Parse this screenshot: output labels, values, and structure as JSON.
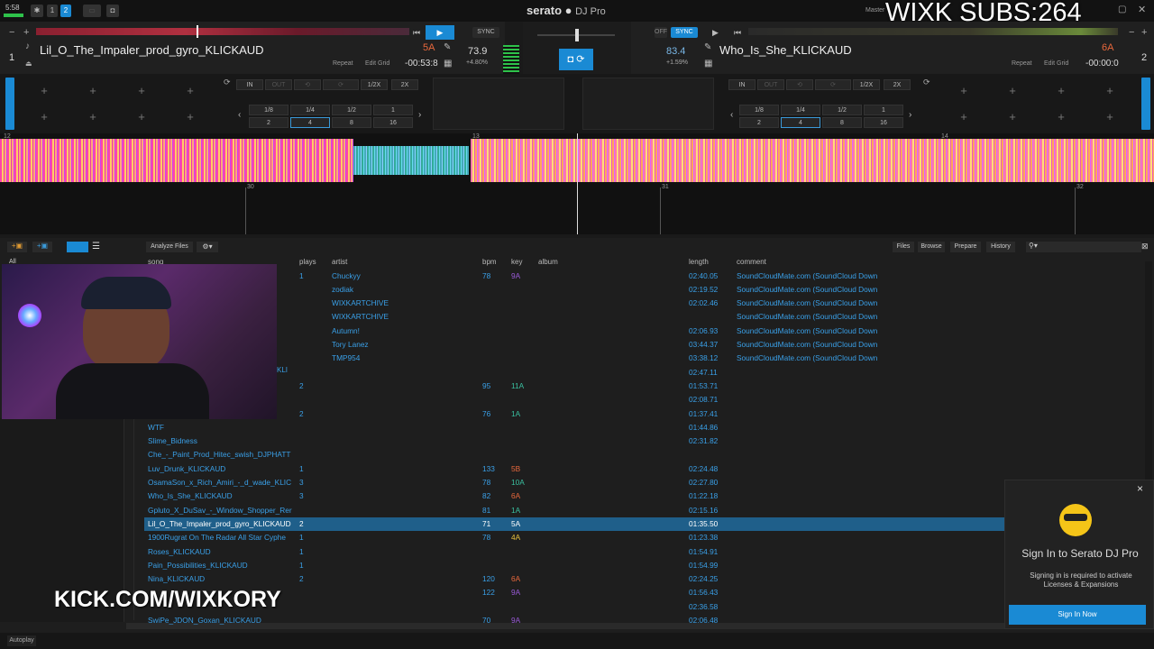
{
  "topbar": {
    "clock": "5:58",
    "deck1_label": "1",
    "deck2_label": "2",
    "logo": "serato",
    "logo_sub": "DJ Pro",
    "overlay_subs": "WIXK SUBS:264",
    "master_label": "Master"
  },
  "deck_left": {
    "number": "1",
    "title": "Lil_O_The_Impaler_prod_gyro_KLICKAUD",
    "key": "5A",
    "time": "-00:53:8",
    "repeat": "Repeat",
    "edit_grid": "Edit Grid",
    "bpm": "73.9",
    "pitch": "+4.80%",
    "sync": "SYNC"
  },
  "deck_right": {
    "number": "2",
    "title": "Who_Is_She_KLICKAUD",
    "key": "6A",
    "time": "-00:00:0",
    "repeat": "Repeat",
    "edit_grid": "Edit Grid",
    "bpm": "83.4",
    "pitch": "+1.59%",
    "sync": "SYNC",
    "off": "OFF"
  },
  "loop_controls": {
    "in": "IN",
    "out": "OUT",
    "half": "1/2X",
    "double": "2X",
    "sizes_top": [
      "1/8",
      "1/4",
      "1/2",
      "1"
    ],
    "sizes_bottom": [
      "2",
      "4",
      "8",
      "16"
    ]
  },
  "wave_markers": {
    "top": [
      "12",
      "13",
      "14"
    ],
    "bottom": [
      "30",
      "31",
      "32"
    ]
  },
  "browser_toolbar": {
    "analyze": "Analyze Files",
    "files": "Files",
    "browse": "Browse",
    "prepare": "Prepare",
    "history": "History",
    "all": "All"
  },
  "columns": {
    "song": "song",
    "plays": "plays",
    "artist": "artist",
    "bpm": "bpm",
    "key": "key",
    "album": "album",
    "length": "length",
    "comment": "comment"
  },
  "tracks": [
    {
      "song": "",
      "plays": "1",
      "artist": "Chuckyy",
      "bpm": "78",
      "key": "9A",
      "length": "02:40.05",
      "comment": "SoundCloudMate.com (SoundCloud Down"
    },
    {
      "song": "",
      "plays": "",
      "artist": "zodiak",
      "bpm": "",
      "key": "",
      "length": "02:19.52",
      "comment": "SoundCloudMate.com (SoundCloud Down"
    },
    {
      "song": "",
      "plays": "",
      "artist": "WIXKARTCHIVE",
      "bpm": "",
      "key": "",
      "length": "02:02.46",
      "comment": "SoundCloudMate.com (SoundCloud Down"
    },
    {
      "song": "",
      "plays": "",
      "artist": "WIXKARTCHIVE",
      "bpm": "",
      "key": "",
      "length": "",
      "comment": "SoundCloudMate.com (SoundCloud Down"
    },
    {
      "song": "",
      "plays": "",
      "artist": "Autumn!",
      "bpm": "",
      "key": "",
      "length": "02:06.93",
      "comment": "SoundCloudMate.com (SoundCloud Down"
    },
    {
      "song": "",
      "plays": "",
      "artist": "Tory Lanez",
      "bpm": "",
      "key": "",
      "length": "03:44.37",
      "comment": "SoundCloudMate.com (SoundCloud Down"
    },
    {
      "song": "",
      "plays": "",
      "artist": "TMP954",
      "bpm": "",
      "key": "",
      "length": "03:38.12",
      "comment": "SoundCloudMate.com (SoundCloud Down"
    },
    {
      "song": "",
      "plays": "",
      "artist": "",
      "bpm": "",
      "key": "",
      "length": "02:47.11",
      "comment": ""
    },
    {
      "song": "",
      "plays": "2",
      "artist": "",
      "bpm": "95",
      "key": "11A",
      "length": "01:53.71",
      "comment": ""
    },
    {
      "song": "",
      "plays": "",
      "artist": "",
      "bpm": "",
      "key": "",
      "length": "02:08.71",
      "comment": ""
    },
    {
      "song": "",
      "plays": "2",
      "artist": "",
      "bpm": "76",
      "key": "1A",
      "length": "01:37.41",
      "comment": ""
    },
    {
      "song": "WTF",
      "plays": "",
      "artist": "",
      "bpm": "",
      "key": "",
      "length": "01:44.86",
      "comment": ""
    },
    {
      "song": "Slime_Bidness",
      "plays": "",
      "artist": "",
      "bpm": "",
      "key": "",
      "length": "02:31.82",
      "comment": ""
    },
    {
      "song": "Che_-_Paint_Prod_Hitec_swish_DJPHATT",
      "plays": "",
      "artist": "",
      "bpm": "",
      "key": "",
      "length": "",
      "comment": ""
    },
    {
      "song": "Luv_Drunk_KLICKAUD",
      "plays": "1",
      "artist": "",
      "bpm": "133",
      "key": "5B",
      "length": "02:24.48",
      "comment": ""
    },
    {
      "song": "OsamaSon_x_Rich_Amiri_-_d_wade_KLIC",
      "plays": "3",
      "artist": "",
      "bpm": "78",
      "key": "10A",
      "length": "02:27.80",
      "comment": ""
    },
    {
      "song": "Who_Is_She_KLICKAUD",
      "plays": "3",
      "artist": "",
      "bpm": "82",
      "key": "6A",
      "length": "01:22.18",
      "comment": ""
    },
    {
      "song": "Gpluto_X_DuSav_-_Window_Shopper_Rer",
      "plays": "",
      "artist": "",
      "bpm": "81",
      "key": "1A",
      "length": "02:15.16",
      "comment": ""
    },
    {
      "song": "Lil_O_The_Impaler_prod_gyro_KLICKAUD",
      "plays": "2",
      "artist": "",
      "bpm": "71",
      "key": "5A",
      "length": "01:35.50",
      "comment": ""
    },
    {
      "song": "1900Rugrat  On The Radar All Star Cyphe",
      "plays": "1",
      "artist": "",
      "bpm": "78",
      "key": "4A",
      "length": "01:23.38",
      "comment": ""
    },
    {
      "song": "Roses_KLICKAUD",
      "plays": "1",
      "artist": "",
      "bpm": "",
      "key": "",
      "length": "01:54.91",
      "comment": ""
    },
    {
      "song": "Pain_Possibilities_KLICKAUD",
      "plays": "1",
      "artist": "",
      "bpm": "",
      "key": "",
      "length": "01:54.99",
      "comment": ""
    },
    {
      "song": "Nina_KLICKAUD",
      "plays": "2",
      "artist": "",
      "bpm": "120",
      "key": "6A",
      "length": "02:24.25",
      "comment": ""
    },
    {
      "song": "",
      "plays": "",
      "artist": "",
      "bpm": "122",
      "key": "9A",
      "length": "01:56.43",
      "comment": ""
    },
    {
      "song": "",
      "plays": "",
      "artist": "",
      "bpm": "",
      "key": "",
      "length": "02:36.58",
      "comment": ""
    },
    {
      "song": "SwiPe_JDON_Goxan_KLICKAUD",
      "plays": "",
      "artist": "",
      "bpm": "70",
      "key": "9A",
      "length": "02:06.48",
      "comment": ""
    }
  ],
  "selected_index": 18,
  "partial_song_text": "KLI",
  "signin": {
    "title": "Sign In to Serato DJ Pro",
    "body": "Signing in is required to activate Licenses & Expansions",
    "button": "Sign In Now"
  },
  "overlay_kick": "KICK.COM/WIXKORY",
  "autoplay": "Autoplay",
  "colors": {
    "accent": "#1a8ad4",
    "track_text": "#3aa0e8",
    "key_orange": "#e8683c"
  }
}
